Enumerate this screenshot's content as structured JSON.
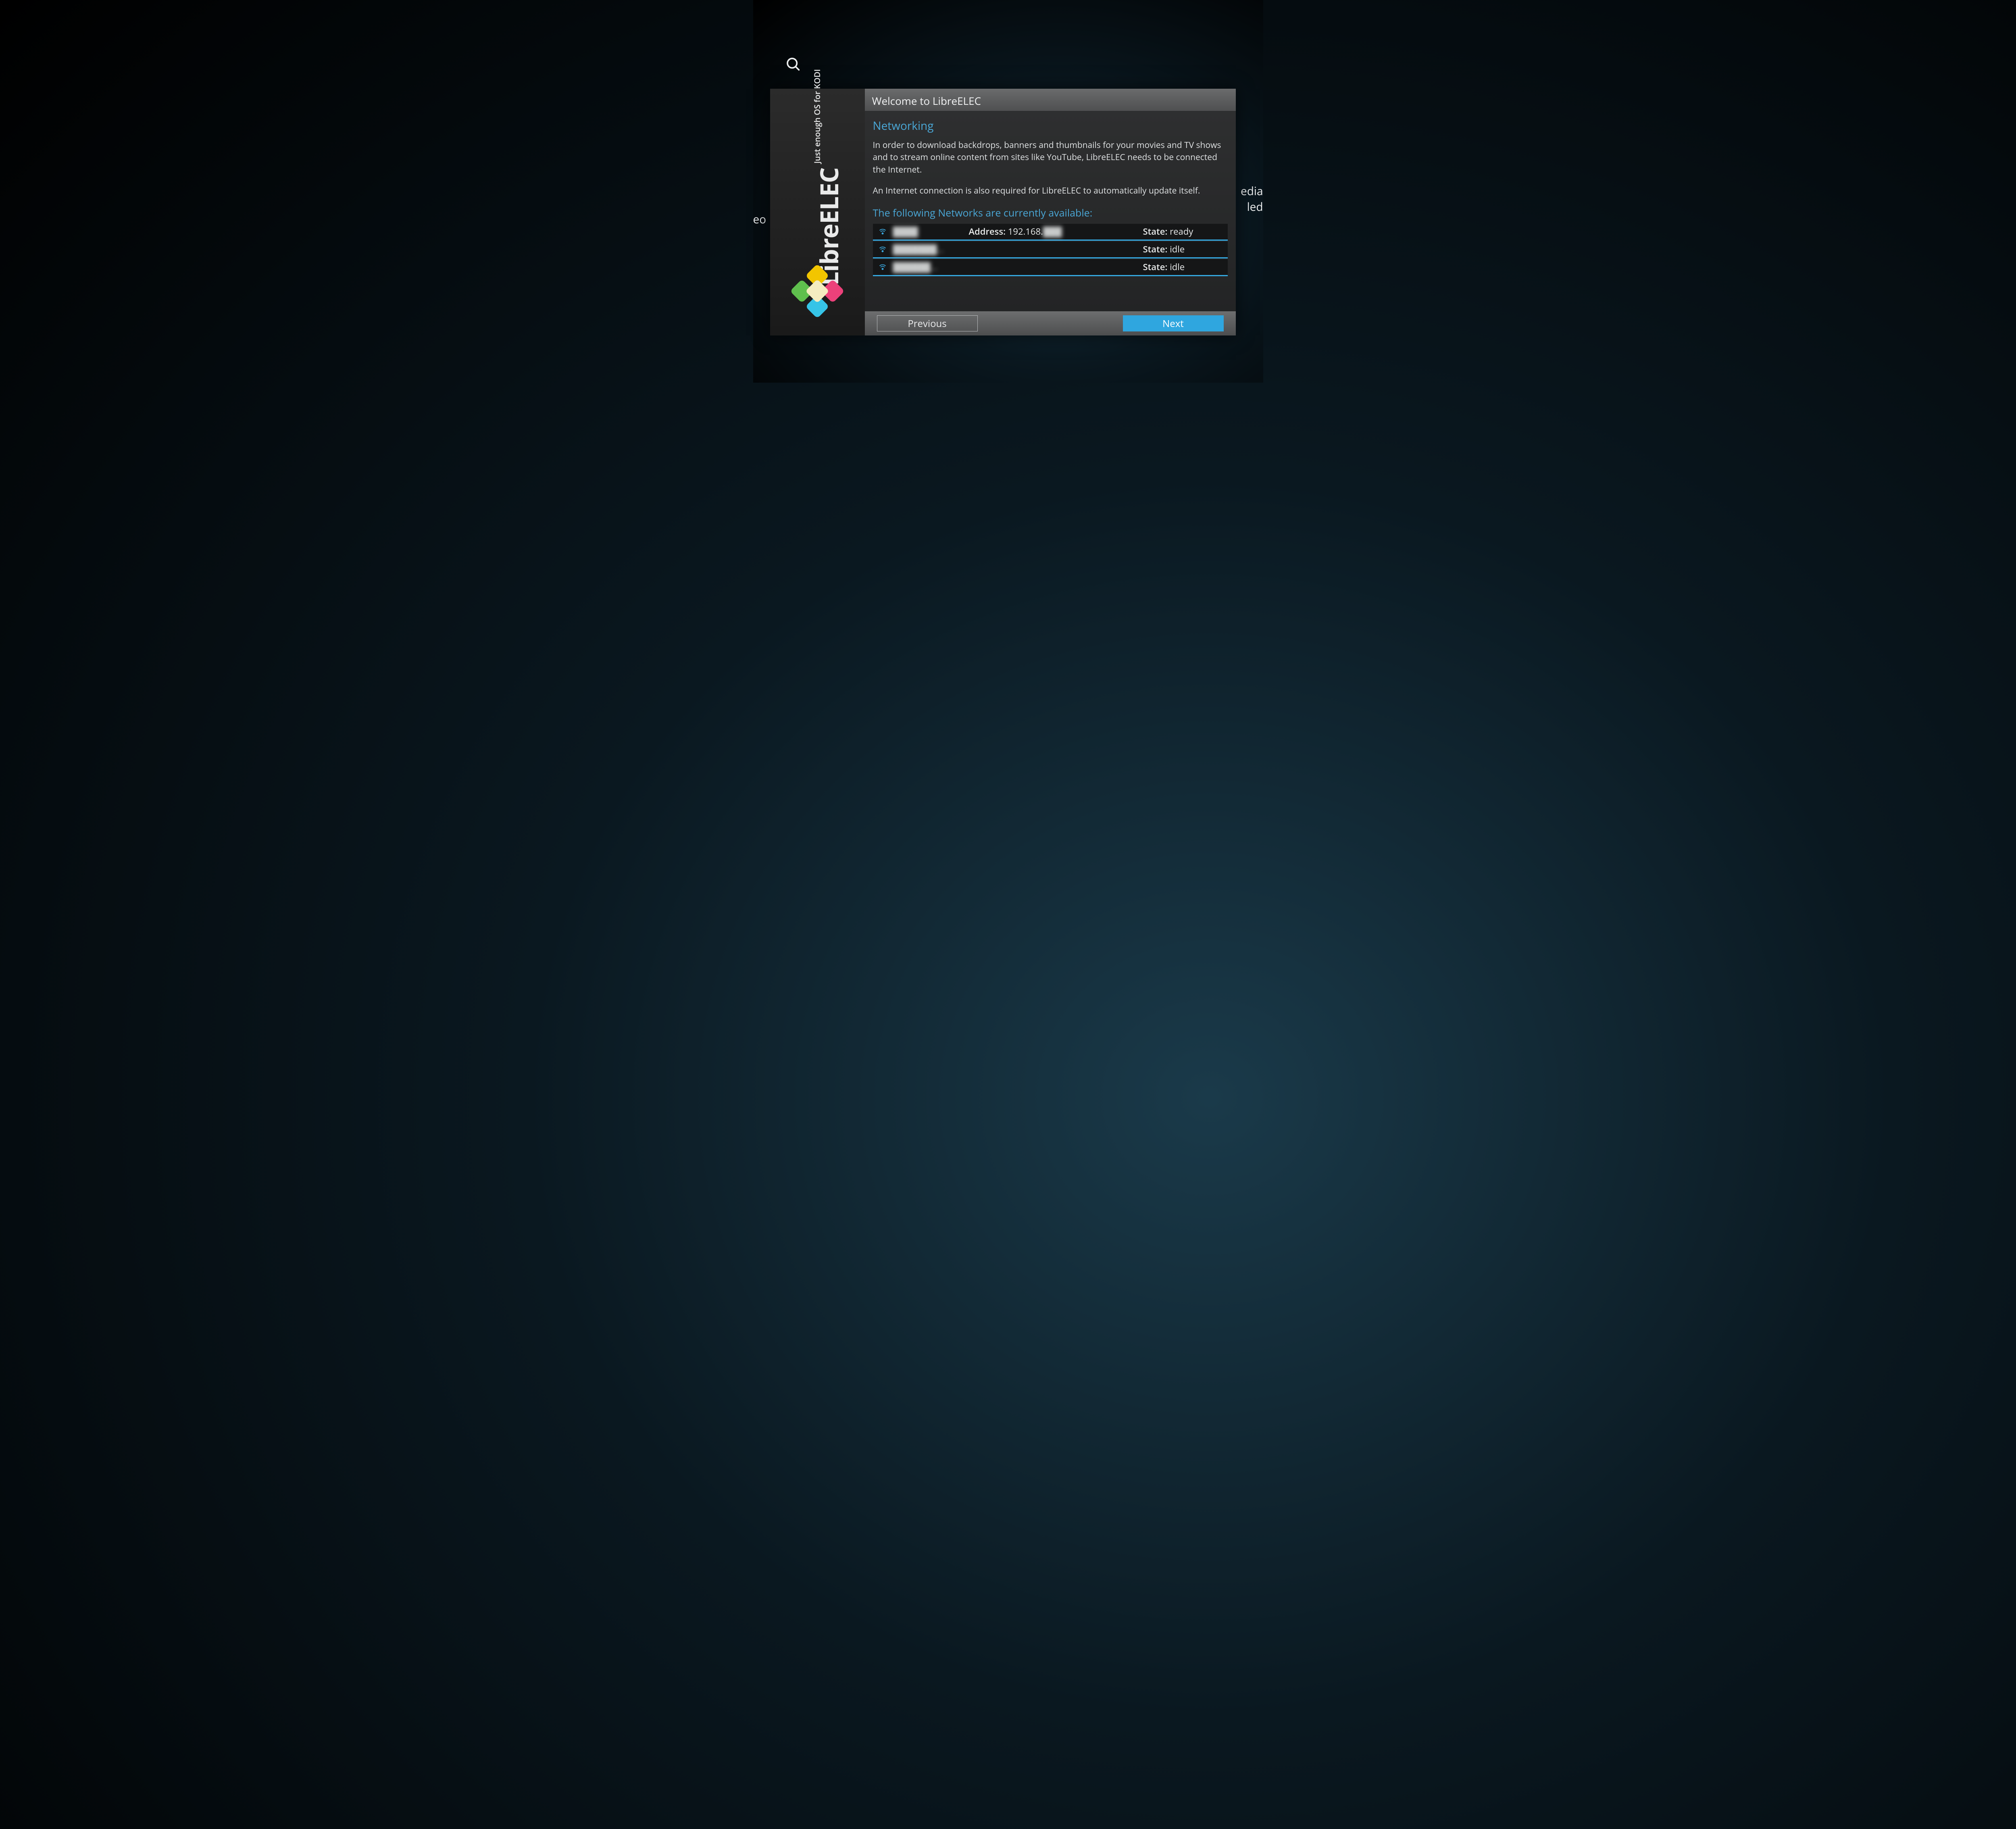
{
  "bg": {
    "left_fragment": "eo",
    "right_fragment_line1": "edia",
    "right_fragment_line2": "led"
  },
  "brand": {
    "name": "LibreELEC",
    "tagline": "Just enough OS for KODI"
  },
  "header": {
    "title": "Welcome to LibreELEC"
  },
  "section": {
    "title": "Networking",
    "paragraph1": "In order to download backdrops, banners and thumbnails for your movies and TV shows and to stream online content from sites like YouTube, LibreELEC needs to be connected the Internet.",
    "paragraph2": "An Internet connection is also required for LibreELEC to automatically update itself.",
    "networks_title": "The following Networks are currently available:"
  },
  "networks": [
    {
      "name": "████",
      "address_label": "Address:",
      "address_visible": "192.168.",
      "address_blurred": "███",
      "state_label": "State:",
      "state_value": "ready"
    },
    {
      "name": "███████...",
      "address_label": "",
      "address_visible": "",
      "address_blurred": "",
      "state_label": "State:",
      "state_value": "idle"
    },
    {
      "name": "██████...",
      "address_label": "",
      "address_visible": "",
      "address_blurred": "",
      "state_label": "State:",
      "state_value": "idle"
    }
  ],
  "footer": {
    "previous": "Previous",
    "next": "Next"
  }
}
